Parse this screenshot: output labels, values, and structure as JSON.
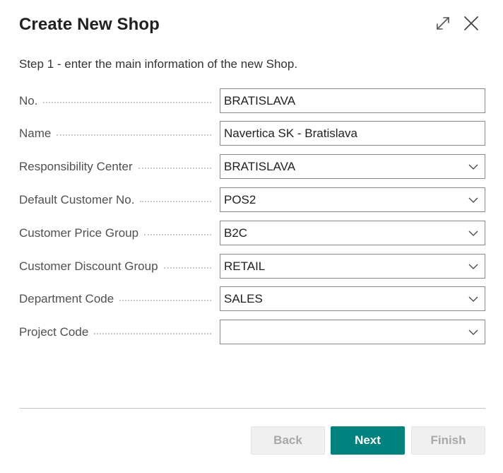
{
  "dialog": {
    "title": "Create New Shop",
    "step_text": "Step 1 - enter the main information of the new Shop."
  },
  "header_icons": {
    "expand": "expand-icon",
    "close": "close-icon"
  },
  "fields": [
    {
      "label": "No.",
      "value": "BRATISLAVA",
      "type": "text"
    },
    {
      "label": "Name",
      "value": "Navertica SK - Bratislava",
      "type": "text"
    },
    {
      "label": "Responsibility Center",
      "value": "BRATISLAVA",
      "type": "dropdown"
    },
    {
      "label": "Default Customer No.",
      "value": "POS2",
      "type": "dropdown"
    },
    {
      "label": "Customer Price Group",
      "value": "B2C",
      "type": "dropdown"
    },
    {
      "label": "Customer Discount Group",
      "value": "RETAIL",
      "type": "dropdown"
    },
    {
      "label": "Department Code",
      "value": "SALES",
      "type": "dropdown"
    },
    {
      "label": "Project Code",
      "value": "",
      "type": "dropdown"
    }
  ],
  "buttons": {
    "back": "Back",
    "next": "Next",
    "finish": "Finish"
  },
  "colors": {
    "primary": "#00827f",
    "disabled_bg": "#f0f0f0",
    "disabled_text": "#a8a8a8"
  }
}
